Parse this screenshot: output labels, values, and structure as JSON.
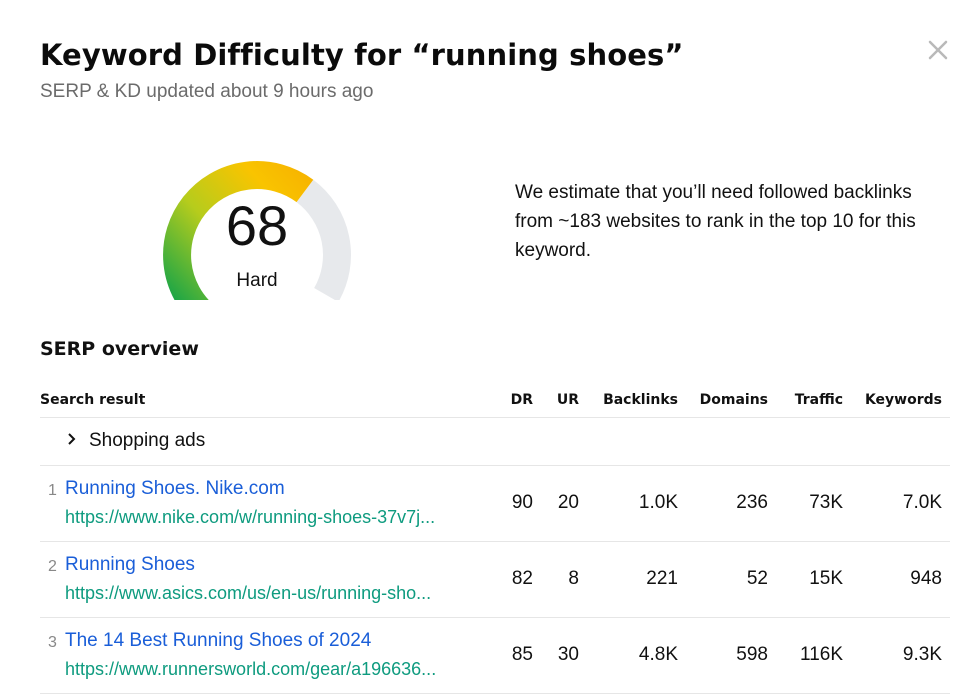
{
  "header": {
    "title": "Keyword Difficulty for “running shoes”",
    "subtitle": "SERP & KD updated about 9 hours ago"
  },
  "gauge": {
    "value": "68",
    "label": "Hard",
    "level": 68,
    "colors": {
      "green": "#0aa14b",
      "yellow_green": "#b6cc1c",
      "yellow": "#f9c400",
      "track": "#e7e9ec"
    }
  },
  "estimate": {
    "text": "We estimate that you’ll need followed backlinks from ~183 websites to rank in the top 10 for this keyword."
  },
  "serp": {
    "section_title": "SERP overview",
    "columns": {
      "search_result": "Search result",
      "dr": "DR",
      "ur": "UR",
      "backlinks": "Backlinks",
      "domains": "Domains",
      "traffic": "Traffic",
      "keywords": "Keywords"
    },
    "shopping_ads": "Shopping ads",
    "rows": [
      {
        "pos": "1",
        "title": "Running Shoes. Nike.com",
        "url": "https://www.nike.com/w/running-shoes-37v7j...",
        "dr": "90",
        "ur": "20",
        "backlinks": "1.0K",
        "domains": "236",
        "traffic": "73K",
        "keywords": "7.0K"
      },
      {
        "pos": "2",
        "title": "Running Shoes",
        "url": "https://www.asics.com/us/en-us/running-sho...",
        "dr": "82",
        "ur": "8",
        "backlinks": "221",
        "domains": "52",
        "traffic": "15K",
        "keywords": "948"
      },
      {
        "pos": "3",
        "title": "The 14 Best Running Shoes of 2024",
        "url": "https://www.runnersworld.com/gear/a196636...",
        "dr": "85",
        "ur": "30",
        "backlinks": "4.8K",
        "domains": "598",
        "traffic": "116K",
        "keywords": "9.3K"
      }
    ]
  },
  "icons": {
    "close": "close-icon",
    "chevron": "chevron-right-icon"
  }
}
